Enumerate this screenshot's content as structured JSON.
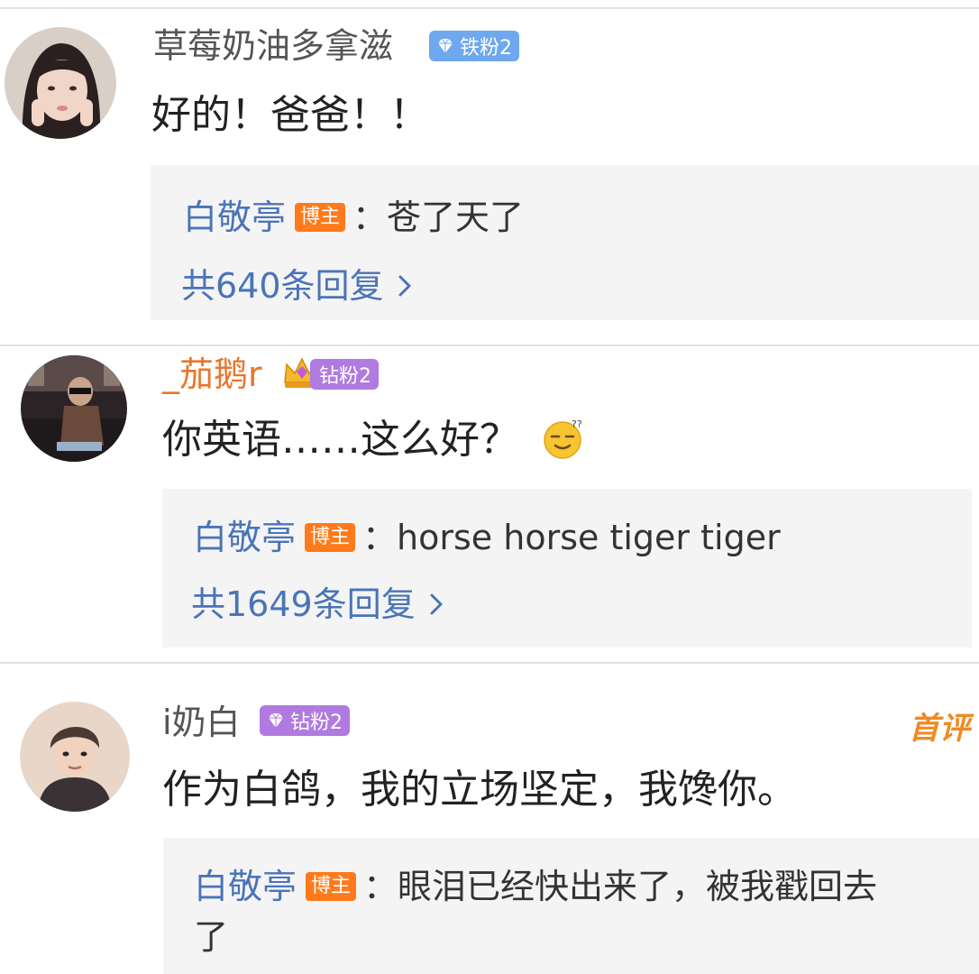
{
  "comments": [
    {
      "username": "草莓奶油多拿滋",
      "badge": "铁粉2",
      "text": "好的！爸爸！！",
      "reply": {
        "name": "白敬亭",
        "host_label": "博主",
        "sep": "：",
        "text": "苍了天了",
        "count": "共640条回复"
      }
    },
    {
      "username": "_茄鹅r",
      "badge": "钻粉2",
      "text": "你英语……这么好？",
      "reply": {
        "name": "白敬亭",
        "host_label": "博主",
        "sep": "：",
        "text": "horse horse tiger tiger",
        "count": "共1649条回复"
      }
    },
    {
      "username": "i奶白",
      "badge": "钻粉2",
      "first_tag": "首评",
      "text": "作为白鸽，我的立场坚定，我馋你。",
      "reply": {
        "name": "白敬亭",
        "host_label": "博主",
        "sep": "：",
        "text": "眼泪已经快出来了，被我戳回去",
        "text_cont": "了"
      }
    }
  ],
  "icons": {
    "badge_gem": "diamond-icon",
    "crown": "crown-icon",
    "emoji": "sweat-emoji-icon",
    "chevron": "chevron-right-icon"
  },
  "colors": {
    "link": "#4a74b8",
    "host_badge": "#ff7a1a",
    "iron_badge": "#6ea8ee",
    "diamond_badge": "#b07ae0",
    "first_tag": "#f08a24"
  }
}
